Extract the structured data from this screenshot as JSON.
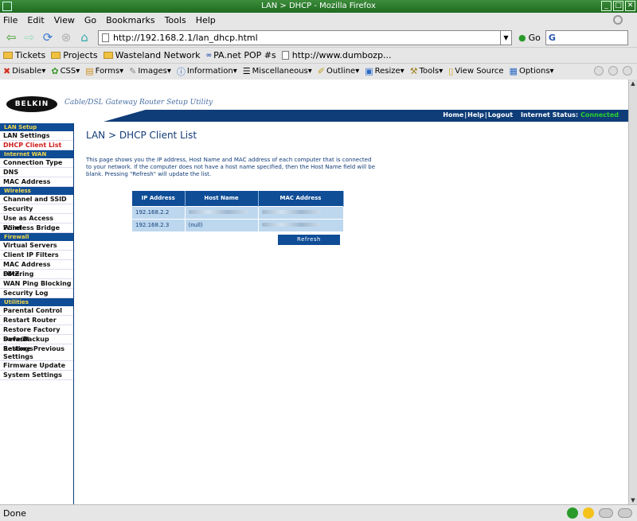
{
  "window": {
    "title": "LAN > DHCP - Mozilla Firefox"
  },
  "menu": [
    "File",
    "Edit",
    "View",
    "Go",
    "Bookmarks",
    "Tools",
    "Help"
  ],
  "nav": {
    "url": "http://192.168.2.1/lan_dhcp.html",
    "go_label": "Go",
    "search_placeholder": "G"
  },
  "bookmarks": [
    "Tickets",
    "Projects",
    "Wasteland Network",
    "PA.net POP #s",
    "http://www.dumbozp..."
  ],
  "devbar": [
    "Disable▾",
    "CSS▾",
    "Forms▾",
    "Images▾",
    "Information▾",
    "Miscellaneous▾",
    "Outline▾",
    "Resize▾",
    "Tools▾",
    "View Source",
    "Options▾"
  ],
  "header": {
    "logo": "BELKIN",
    "subtitle": "Cable/DSL Gateway Router Setup Utility",
    "links": [
      "Home",
      "Help",
      "Logout"
    ],
    "internet_status_label": "Internet Status:",
    "internet_status_value": "Connected",
    "status_color": "#29d12d"
  },
  "sidebar": {
    "sections": [
      {
        "title": "LAN Setup",
        "items": [
          "LAN Settings",
          "DHCP Client List"
        ]
      },
      {
        "title": "Internet WAN",
        "items": [
          "Connection Type",
          "DNS",
          "MAC Address"
        ]
      },
      {
        "title": "Wireless",
        "items": [
          "Channel and SSID",
          "Security",
          "Use as Access Point",
          "Wireless Bridge"
        ]
      },
      {
        "title": "Firewall",
        "items": [
          "Virtual Servers",
          "Client IP Filters",
          "MAC Address Filtering",
          "DMZ",
          "WAN Ping Blocking",
          "Security Log"
        ]
      },
      {
        "title": "Utilities",
        "items": [
          "Parental Control",
          "Restart Router",
          "Restore Factory Default",
          "Save/Backup Settings",
          "Restore Previous Settings",
          "Firmware Update",
          "System Settings"
        ]
      }
    ]
  },
  "main": {
    "title": "LAN > DHCP Client List",
    "description": "This page shows you the IP address, Host Name and MAC address of each computer that is connected to your network. If the computer does not have a host name specified, then the Host Name field will be blank. Pressing \"Refresh\" will update the list.",
    "table": {
      "headers": [
        "IP Address",
        "Host Name",
        "MAC Address"
      ],
      "rows": [
        {
          "ip": "192.168.2.2",
          "host": "",
          "mac": ""
        },
        {
          "ip": "192.168.2.3",
          "host": "(null)",
          "mac": ""
        }
      ]
    },
    "refresh_label": "Refresh"
  },
  "status": {
    "text": "Done"
  }
}
